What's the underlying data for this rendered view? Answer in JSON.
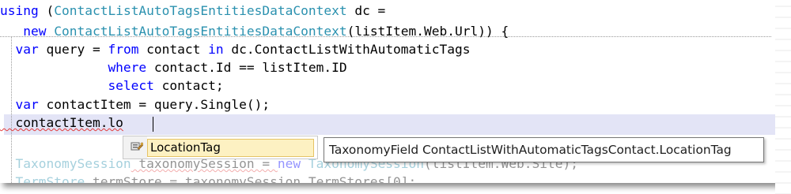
{
  "code_lines": [
    {
      "id": 1,
      "tokens": [
        {
          "t": "using",
          "c": "kw"
        },
        {
          "t": " (",
          "c": "plain"
        },
        {
          "t": "ContactListAutoTagsEntitiesDataContext",
          "c": "type"
        },
        {
          "t": " dc =",
          "c": "plain"
        }
      ]
    },
    {
      "id": 2,
      "tokens": [
        {
          "t": "   new ",
          "c": "kw"
        },
        {
          "t": "ContactListAutoTagsEntitiesDataContext",
          "c": "type"
        },
        {
          "t": "(listItem.Web.Url)) {",
          "c": "plain"
        }
      ]
    },
    {
      "id": 3,
      "tokens": [
        {
          "t": "  var",
          "c": "kw"
        },
        {
          "t": " query = ",
          "c": "plain"
        },
        {
          "t": "from",
          "c": "kw"
        },
        {
          "t": " contact ",
          "c": "plain"
        },
        {
          "t": "in",
          "c": "kw"
        },
        {
          "t": " dc.ContactListWithAutomaticTags",
          "c": "plain"
        }
      ]
    },
    {
      "id": 4,
      "tokens": [
        {
          "t": "              where",
          "c": "kw"
        },
        {
          "t": " contact.Id == listItem.ID",
          "c": "plain"
        }
      ]
    },
    {
      "id": 5,
      "tokens": [
        {
          "t": "              select",
          "c": "kw"
        },
        {
          "t": " contact;",
          "c": "plain"
        }
      ]
    },
    {
      "id": 6,
      "tokens": [
        {
          "t": "  var",
          "c": "kw"
        },
        {
          "t": " contactItem = query.Single();",
          "c": "plain"
        }
      ]
    },
    {
      "id": 7,
      "tokens": [
        {
          "t": "  contactItem.lo",
          "c": "plain",
          "squiggle": true
        }
      ]
    },
    {
      "id": 8,
      "tokens": [
        {
          "t": "  TaxonomySession",
          "c": "type"
        },
        {
          "t": " taxonomySession = ",
          "c": "plain",
          "squiggle": true
        },
        {
          "t": "new",
          "c": "kw"
        },
        {
          "t": " TaxonomySession",
          "c": "type"
        },
        {
          "t": "(listItem.Web.Site);",
          "c": "plain"
        }
      ],
      "faded": true
    },
    {
      "id": 9,
      "tokens": [
        {
          "t": "  TermStore",
          "c": "type"
        },
        {
          "t": " termStore = taxonomySession.TermStores[0];",
          "c": "plain"
        }
      ],
      "faded": true
    }
  ],
  "intellisense": {
    "icon": "property-icon",
    "selected_item": "LocationTag",
    "tooltip": "TaxonomyField ContactListWithAutomaticTagsContact.LocationTag"
  },
  "colors": {
    "keyword": "#0000ff",
    "type": "#2b91af",
    "current_line": "#e3e4f6",
    "selection": "#fdf1c2"
  }
}
